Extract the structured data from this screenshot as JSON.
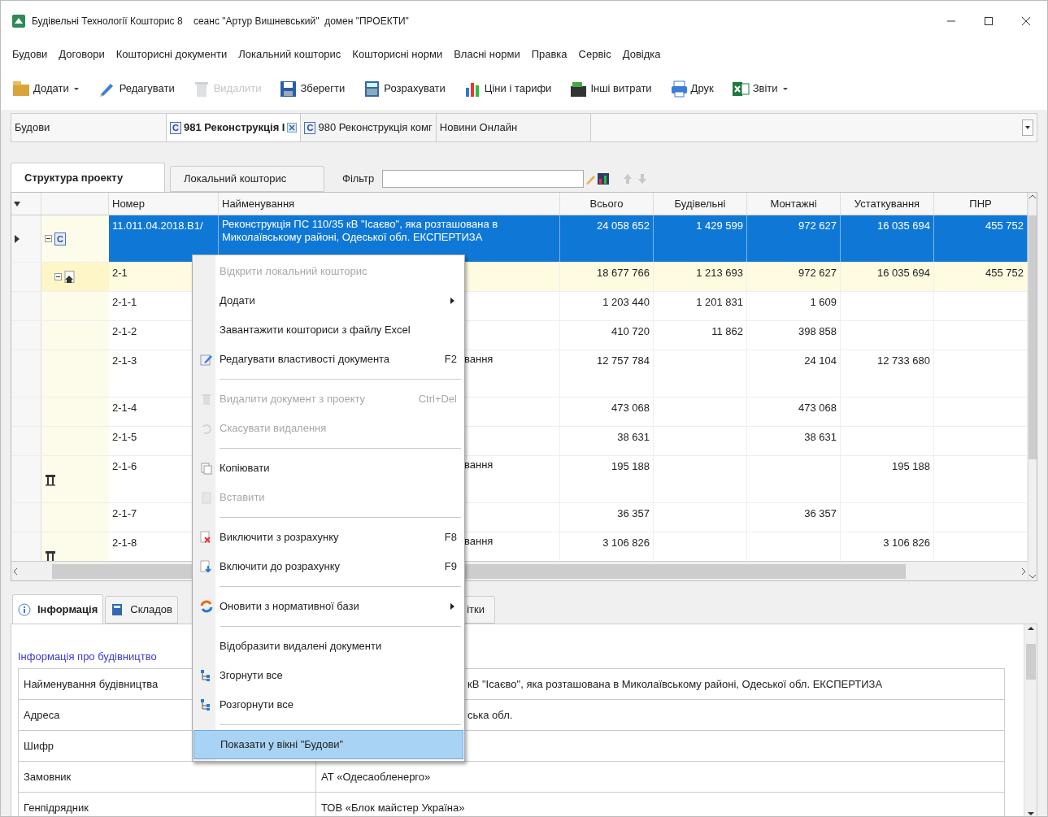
{
  "window": {
    "title": "Будівельні Технології Кошторис 8    сеанс \"Артур Вишневський\"  домен \"ПРОЕКТИ\""
  },
  "menu_bar": [
    "Будови",
    "Договори",
    "Кошторисні документи",
    "Локальний кошторис",
    "Кошторисні норми",
    "Власні норми",
    "Правка",
    "Сервіс",
    "Довідка"
  ],
  "toolbar": [
    {
      "kind": "add",
      "label": "Додати",
      "disabled": false,
      "dropdown": true
    },
    {
      "kind": "edit",
      "label": "Редагувати",
      "disabled": false,
      "dropdown": false
    },
    {
      "kind": "delete",
      "label": "Видалити",
      "disabled": true,
      "dropdown": false
    },
    {
      "kind": "save",
      "label": "Зберегти",
      "disabled": false,
      "dropdown": false
    },
    {
      "kind": "calc",
      "label": "Розрахувати",
      "disabled": false,
      "dropdown": false
    },
    {
      "kind": "prices",
      "label": "Ціни і тарифи",
      "disabled": false,
      "dropdown": false
    },
    {
      "kind": "costs",
      "label": "Інші витрати",
      "disabled": false,
      "dropdown": false
    },
    {
      "kind": "print",
      "label": "Друк",
      "disabled": false,
      "dropdown": false
    },
    {
      "kind": "reports",
      "label": "Звіти",
      "disabled": false,
      "dropdown": true
    }
  ],
  "document_tabs": {
    "panel_title": "Будови",
    "tabs": [
      {
        "badge": "C",
        "label": "981 Реконструкція І",
        "selected": true,
        "closable": true
      },
      {
        "badge": "C",
        "label": "980 Реконструкція комг",
        "selected": false,
        "closable": false
      },
      {
        "label": "Новини Онлайн",
        "selected": false,
        "closable": false
      }
    ]
  },
  "view_tabs": [
    {
      "label": "Структура проекту",
      "selected": true
    },
    {
      "label": "Локальний кошторис",
      "selected": false
    }
  ],
  "filter": {
    "label": "Фільтр"
  },
  "grid": {
    "columns": [
      "Номер",
      "Найменування",
      "Всього",
      "Будівельні",
      "Монтажні",
      "Устаткування",
      "ПНР"
    ],
    "rows": [
      {
        "kind": "project",
        "badge": "C",
        "number": "11.011.04.2018.В1/",
        "name": "Реконструкція ПС 110/35 кВ \"Ісаєво\", яка розташована в Миколаївському районі, Одеської обл. ЕКСПЕРТИЗА",
        "values": {
          "total": "24 058 652",
          "construction": "1 429 599",
          "installation": "972 627",
          "equipment": "16 035 694",
          "commissioning": "455 752"
        },
        "selected": true,
        "highlighted": false,
        "expanded": true
      },
      {
        "kind": "object",
        "number": "2-1",
        "values": {
          "total": "18 677 766",
          "construction": "1 213 693",
          "installation": "972 627",
          "equipment": "16 035 694",
          "commissioning": "455 752"
        },
        "selected": false,
        "highlighted": true,
        "expanded": true
      },
      {
        "kind": "estimate",
        "number": "2-1-1",
        "values": {
          "total": "1 203 440",
          "construction": "1 201 831",
          "installation": "1 609"
        },
        "selected": false,
        "highlighted": false
      },
      {
        "kind": "estimate",
        "number": "2-1-2",
        "values": {
          "total": "410 720",
          "construction": "11 862",
          "installation": "398 858"
        },
        "selected": false,
        "highlighted": false
      },
      {
        "kind": "estimate",
        "number": "2-1-3",
        "name": "вання",
        "values": {
          "total": "12 757 784",
          "installation": "24 104",
          "equipment": "12 733 680"
        },
        "selected": false,
        "highlighted": false
      },
      {
        "kind": "estimate",
        "number": "2-1-4",
        "values": {
          "total": "473 068",
          "installation": "473 068"
        },
        "selected": false,
        "highlighted": false
      },
      {
        "kind": "estimate",
        "number": "2-1-5",
        "values": {
          "total": "38 631",
          "installation": "38 631"
        },
        "selected": false,
        "highlighted": false
      },
      {
        "kind": "equipment",
        "number": "2-1-6",
        "name": "вання",
        "values": {
          "total": "195 188",
          "equipment": "195 188"
        },
        "selected": false,
        "highlighted": false
      },
      {
        "kind": "estimate",
        "number": "2-1-7",
        "values": {
          "total": "36 357",
          "installation": "36 357"
        },
        "selected": false,
        "highlighted": false
      },
      {
        "kind": "equipment",
        "number": "2-1-8",
        "name": "вання",
        "values": {
          "total": "3 106 826",
          "equipment": "3 106 826"
        },
        "selected": false,
        "highlighted": false
      }
    ]
  },
  "context_menu": [
    {
      "kind": "item",
      "label": "Відкрити локальний кошторис",
      "disabled": true,
      "selected": false
    },
    {
      "kind": "item",
      "label": "Додати",
      "disabled": false,
      "submenu": true,
      "selected": false
    },
    {
      "kind": "item",
      "label": "Завантажити кошториси з файлу Excel",
      "disabled": false,
      "selected": false
    },
    {
      "kind": "item",
      "label": "Редагувати властивості документа",
      "shortcut": "F2",
      "disabled": false,
      "selected": false
    },
    {
      "kind": "separator"
    },
    {
      "kind": "item",
      "label": "Видалити документ з проекту",
      "shortcut": "Ctrl+Del",
      "disabled": true,
      "selected": false
    },
    {
      "kind": "item",
      "label": "Скасувати видалення",
      "disabled": true,
      "selected": false
    },
    {
      "kind": "separator"
    },
    {
      "kind": "item",
      "label": "Копіювати",
      "disabled": false,
      "selected": false
    },
    {
      "kind": "item",
      "label": "Вставити",
      "disabled": true,
      "selected": false
    },
    {
      "kind": "separator"
    },
    {
      "kind": "item",
      "label": "Виключити з розрахунку",
      "shortcut": "F8",
      "disabled": false,
      "selected": false
    },
    {
      "kind": "item",
      "label": "Включити до розрахунку",
      "shortcut": "F9",
      "disabled": false,
      "selected": false
    },
    {
      "kind": "separator"
    },
    {
      "kind": "item",
      "label": "Оновити з нормативної бази",
      "disabled": false,
      "submenu": true,
      "selected": false
    },
    {
      "kind": "separator"
    },
    {
      "kind": "item",
      "label": "Відобразити видалені документи",
      "disabled": false,
      "selected": false
    },
    {
      "kind": "item",
      "label": "Згорнути все",
      "disabled": false,
      "selected": false
    },
    {
      "kind": "item",
      "label": "Розгорнути все",
      "disabled": false,
      "selected": false
    },
    {
      "kind": "separator"
    },
    {
      "kind": "item",
      "label": "Показати у вікні \"Будови\"",
      "disabled": false,
      "selected": true
    }
  ],
  "bottom_tabs": [
    {
      "kind": "info",
      "label": "Інформація",
      "selected": true
    },
    {
      "kind": "calc",
      "label": "Складов",
      "selected": false
    },
    {
      "kind": "plain",
      "label": "ітки",
      "selected": false
    }
  ],
  "info": {
    "heading": "Інформація про будівництво",
    "rows": [
      {
        "label": "Найменування будівництва",
        "value": "кВ \"Ісаєво\", яка розташована в Миколаївському районі, Одеської обл. ЕКСПЕРТИЗА"
      },
      {
        "label": "Адреса",
        "value": "ська обл."
      },
      {
        "label": "Шифр"
      },
      {
        "label": "Замовник",
        "value": "АТ «Одесаобленерго»"
      },
      {
        "label": "Генпідрядник",
        "value": "ТОВ «Блок майстер Україна»"
      }
    ]
  }
}
